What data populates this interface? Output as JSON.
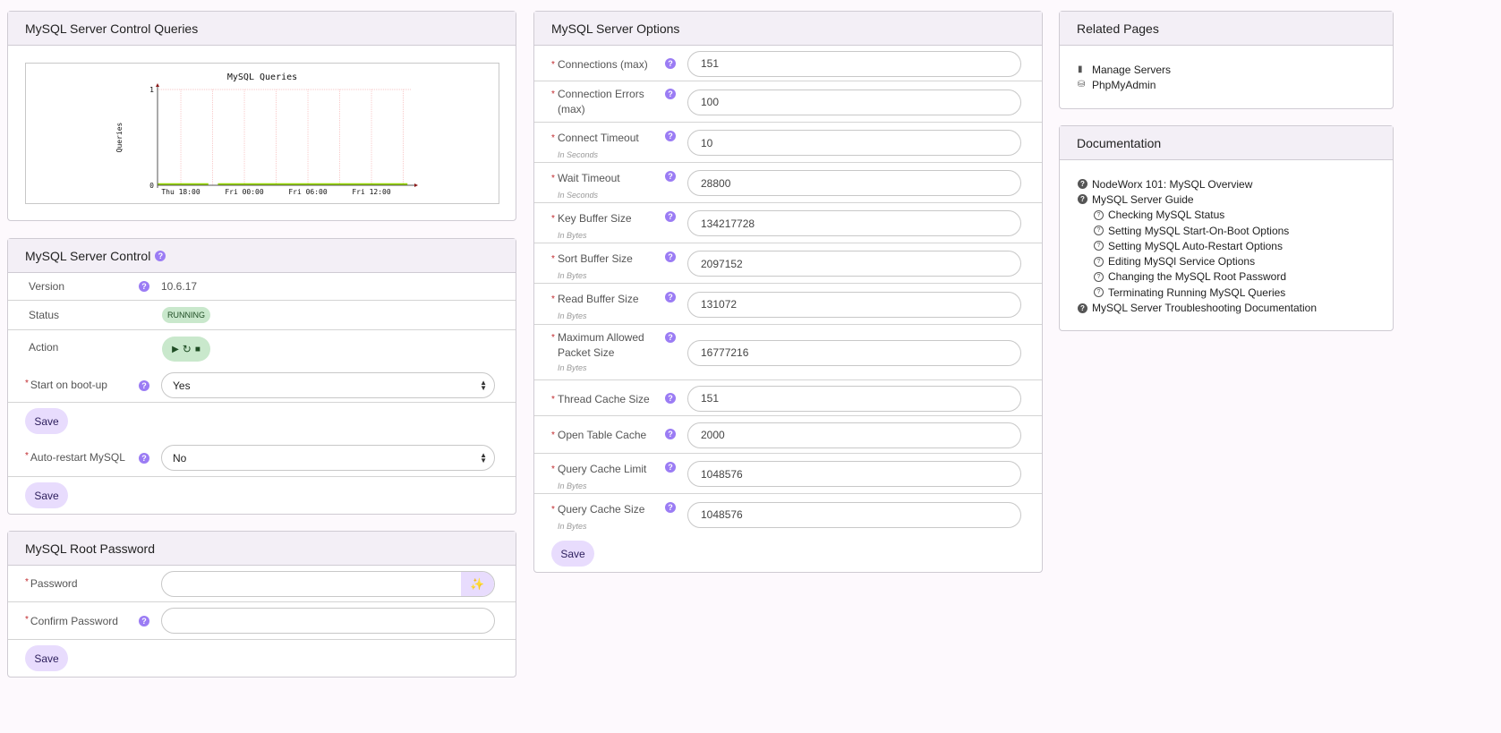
{
  "queries_panel": {
    "title": "MySQL Server Control Queries"
  },
  "chart_data": {
    "type": "line",
    "title": "MySQL Queries",
    "xlabel": "",
    "ylabel": "Queries",
    "x_unit": "hours since Thu 00:00",
    "xlim": [
      15.8,
      39.8
    ],
    "ylim": [
      0,
      1
    ],
    "yticks": [
      0,
      1
    ],
    "xticks": [
      {
        "value": 18,
        "label": "Thu 18:00"
      },
      {
        "value": 24,
        "label": "Fri 00:00"
      },
      {
        "value": 30,
        "label": "Fri 06:00"
      },
      {
        "value": 36,
        "label": "Fri 12:00"
      }
    ],
    "grid": true,
    "series": [
      {
        "name": "Queries",
        "color": "#94d600",
        "segments": [
          [
            [
              15.8,
              0
            ],
            [
              20.6,
              0
            ]
          ],
          [
            [
              21.5,
              0
            ],
            [
              39.4,
              0
            ]
          ]
        ]
      }
    ]
  },
  "control": {
    "title": "MySQL Server Control",
    "version_label": "Version",
    "version_value": "10.6.17",
    "status_label": "Status",
    "status_value": "RUNNING",
    "action_label": "Action",
    "boot_label": "Start on boot-up",
    "boot_value": "Yes",
    "restart_label": "Auto-restart MySQL",
    "restart_value": "No",
    "save": "Save"
  },
  "password": {
    "title": "MySQL Root Password",
    "password_label": "Password",
    "password_value": "",
    "confirm_label": "Confirm Password",
    "confirm_value": "",
    "save": "Save"
  },
  "options": {
    "title": "MySQL Server Options",
    "save": "Save",
    "fields": [
      {
        "label": "Connections (max)",
        "hint": "",
        "value": "151"
      },
      {
        "label": "Connection Errors (max)",
        "hint": "",
        "value": "100"
      },
      {
        "label": "Connect Timeout",
        "hint": "In Seconds",
        "value": "10"
      },
      {
        "label": "Wait Timeout",
        "hint": "In Seconds",
        "value": "28800"
      },
      {
        "label": "Key Buffer Size",
        "hint": "In Bytes",
        "value": "134217728"
      },
      {
        "label": "Sort Buffer Size",
        "hint": "In Bytes",
        "value": "2097152"
      },
      {
        "label": "Read Buffer Size",
        "hint": "In Bytes",
        "value": "131072"
      },
      {
        "label": "Maximum Allowed Packet Size",
        "hint": "In Bytes",
        "value": "16777216"
      },
      {
        "label": "Thread Cache Size",
        "hint": "",
        "value": "151"
      },
      {
        "label": "Open Table Cache",
        "hint": "",
        "value": "2000"
      },
      {
        "label": "Query Cache Limit",
        "hint": "In Bytes",
        "value": "1048576"
      },
      {
        "label": "Query Cache Size",
        "hint": "In Bytes",
        "value": "1048576"
      }
    ]
  },
  "related": {
    "title": "Related Pages",
    "links": [
      {
        "label": "Manage Servers",
        "icon": "server-icon"
      },
      {
        "label": "PhpMyAdmin",
        "icon": "database-search-icon"
      }
    ]
  },
  "docs": {
    "title": "Documentation",
    "links": [
      {
        "label": "NodeWorx 101: MySQL Overview",
        "level": 0
      },
      {
        "label": "MySQL Server Guide",
        "level": 0
      },
      {
        "label": "Checking MySQL Status",
        "level": 1
      },
      {
        "label": "Setting MySQL Start-On-Boot Options",
        "level": 1
      },
      {
        "label": "Setting MySQL Auto-Restart Options",
        "level": 1
      },
      {
        "label": "Editing MySQl Service Options",
        "level": 1
      },
      {
        "label": "Changing the MySQL Root Password",
        "level": 1
      },
      {
        "label": "Terminating Running MySQL Queries",
        "level": 1
      },
      {
        "label": "MySQL Server Troubleshooting Documentation",
        "level": 0
      }
    ]
  },
  "colors": {
    "accent": "#9b7cf4",
    "button_bg": "#e8dcfd",
    "status_bg": "#c9e8cc",
    "header_bg": "#f3eff6"
  }
}
